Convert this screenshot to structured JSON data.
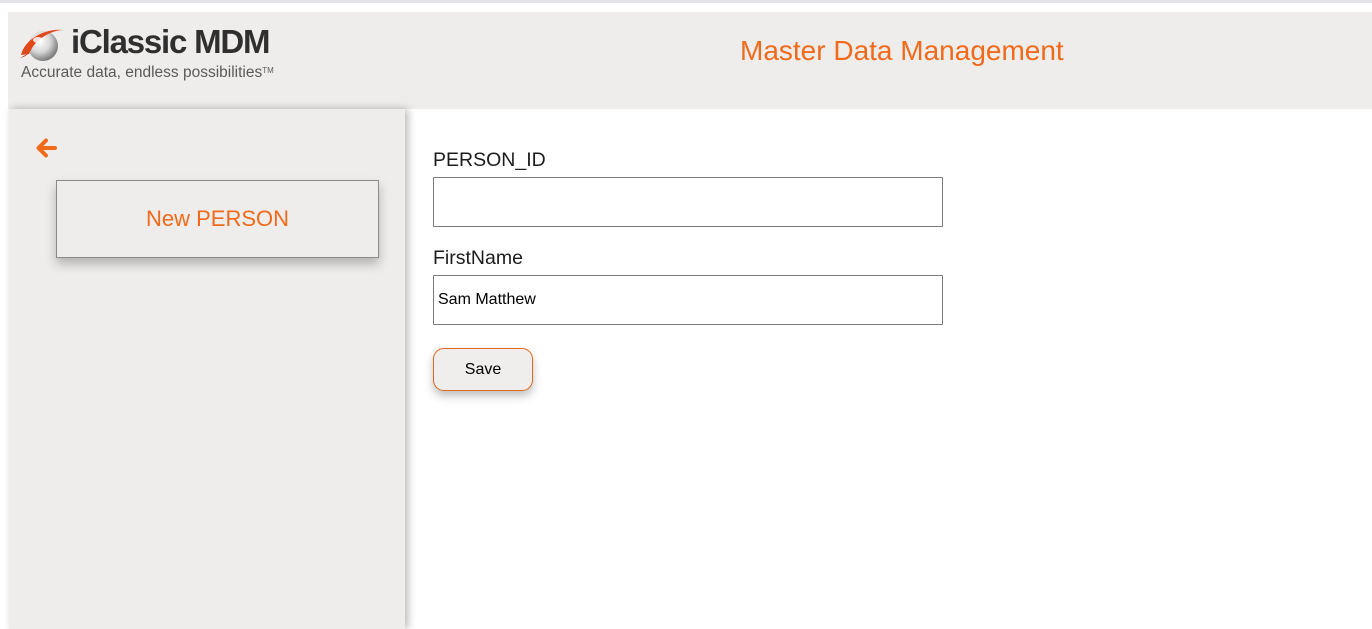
{
  "brand": {
    "name": "iClassic MDM",
    "tagline": "Accurate data, endless possibilities",
    "trademark": "TM"
  },
  "header": {
    "title": "Master Data Management"
  },
  "sidebar": {
    "back_icon": "arrow-left-icon",
    "items": [
      {
        "label": "New PERSON"
      }
    ]
  },
  "form": {
    "fields": [
      {
        "label": "PERSON_ID",
        "value": ""
      },
      {
        "label": "FirstName",
        "value": "Sam Matthew"
      }
    ],
    "save_label": "Save"
  },
  "colors": {
    "accent": "#f06a1a",
    "panel": "#eeedeb"
  }
}
